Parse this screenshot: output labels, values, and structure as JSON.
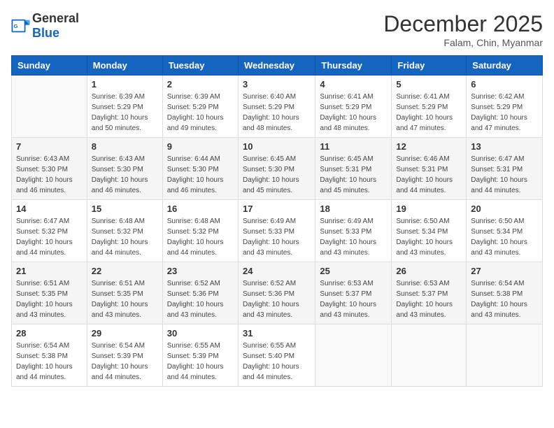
{
  "header": {
    "logo_general": "General",
    "logo_blue": "Blue",
    "month_title": "December 2025",
    "subtitle": "Falam, Chin, Myanmar"
  },
  "columns": [
    "Sunday",
    "Monday",
    "Tuesday",
    "Wednesday",
    "Thursday",
    "Friday",
    "Saturday"
  ],
  "weeks": [
    [
      {
        "day": "",
        "info": ""
      },
      {
        "day": "1",
        "info": "Sunrise: 6:39 AM\nSunset: 5:29 PM\nDaylight: 10 hours\nand 50 minutes."
      },
      {
        "day": "2",
        "info": "Sunrise: 6:39 AM\nSunset: 5:29 PM\nDaylight: 10 hours\nand 49 minutes."
      },
      {
        "day": "3",
        "info": "Sunrise: 6:40 AM\nSunset: 5:29 PM\nDaylight: 10 hours\nand 48 minutes."
      },
      {
        "day": "4",
        "info": "Sunrise: 6:41 AM\nSunset: 5:29 PM\nDaylight: 10 hours\nand 48 minutes."
      },
      {
        "day": "5",
        "info": "Sunrise: 6:41 AM\nSunset: 5:29 PM\nDaylight: 10 hours\nand 47 minutes."
      },
      {
        "day": "6",
        "info": "Sunrise: 6:42 AM\nSunset: 5:29 PM\nDaylight: 10 hours\nand 47 minutes."
      }
    ],
    [
      {
        "day": "7",
        "info": "Sunrise: 6:43 AM\nSunset: 5:30 PM\nDaylight: 10 hours\nand 46 minutes."
      },
      {
        "day": "8",
        "info": "Sunrise: 6:43 AM\nSunset: 5:30 PM\nDaylight: 10 hours\nand 46 minutes."
      },
      {
        "day": "9",
        "info": "Sunrise: 6:44 AM\nSunset: 5:30 PM\nDaylight: 10 hours\nand 46 minutes."
      },
      {
        "day": "10",
        "info": "Sunrise: 6:45 AM\nSunset: 5:30 PM\nDaylight: 10 hours\nand 45 minutes."
      },
      {
        "day": "11",
        "info": "Sunrise: 6:45 AM\nSunset: 5:31 PM\nDaylight: 10 hours\nand 45 minutes."
      },
      {
        "day": "12",
        "info": "Sunrise: 6:46 AM\nSunset: 5:31 PM\nDaylight: 10 hours\nand 44 minutes."
      },
      {
        "day": "13",
        "info": "Sunrise: 6:47 AM\nSunset: 5:31 PM\nDaylight: 10 hours\nand 44 minutes."
      }
    ],
    [
      {
        "day": "14",
        "info": "Sunrise: 6:47 AM\nSunset: 5:32 PM\nDaylight: 10 hours\nand 44 minutes."
      },
      {
        "day": "15",
        "info": "Sunrise: 6:48 AM\nSunset: 5:32 PM\nDaylight: 10 hours\nand 44 minutes."
      },
      {
        "day": "16",
        "info": "Sunrise: 6:48 AM\nSunset: 5:32 PM\nDaylight: 10 hours\nand 44 minutes."
      },
      {
        "day": "17",
        "info": "Sunrise: 6:49 AM\nSunset: 5:33 PM\nDaylight: 10 hours\nand 43 minutes."
      },
      {
        "day": "18",
        "info": "Sunrise: 6:49 AM\nSunset: 5:33 PM\nDaylight: 10 hours\nand 43 minutes."
      },
      {
        "day": "19",
        "info": "Sunrise: 6:50 AM\nSunset: 5:34 PM\nDaylight: 10 hours\nand 43 minutes."
      },
      {
        "day": "20",
        "info": "Sunrise: 6:50 AM\nSunset: 5:34 PM\nDaylight: 10 hours\nand 43 minutes."
      }
    ],
    [
      {
        "day": "21",
        "info": "Sunrise: 6:51 AM\nSunset: 5:35 PM\nDaylight: 10 hours\nand 43 minutes."
      },
      {
        "day": "22",
        "info": "Sunrise: 6:51 AM\nSunset: 5:35 PM\nDaylight: 10 hours\nand 43 minutes."
      },
      {
        "day": "23",
        "info": "Sunrise: 6:52 AM\nSunset: 5:36 PM\nDaylight: 10 hours\nand 43 minutes."
      },
      {
        "day": "24",
        "info": "Sunrise: 6:52 AM\nSunset: 5:36 PM\nDaylight: 10 hours\nand 43 minutes."
      },
      {
        "day": "25",
        "info": "Sunrise: 6:53 AM\nSunset: 5:37 PM\nDaylight: 10 hours\nand 43 minutes."
      },
      {
        "day": "26",
        "info": "Sunrise: 6:53 AM\nSunset: 5:37 PM\nDaylight: 10 hours\nand 43 minutes."
      },
      {
        "day": "27",
        "info": "Sunrise: 6:54 AM\nSunset: 5:38 PM\nDaylight: 10 hours\nand 43 minutes."
      }
    ],
    [
      {
        "day": "28",
        "info": "Sunrise: 6:54 AM\nSunset: 5:38 PM\nDaylight: 10 hours\nand 44 minutes."
      },
      {
        "day": "29",
        "info": "Sunrise: 6:54 AM\nSunset: 5:39 PM\nDaylight: 10 hours\nand 44 minutes."
      },
      {
        "day": "30",
        "info": "Sunrise: 6:55 AM\nSunset: 5:39 PM\nDaylight: 10 hours\nand 44 minutes."
      },
      {
        "day": "31",
        "info": "Sunrise: 6:55 AM\nSunset: 5:40 PM\nDaylight: 10 hours\nand 44 minutes."
      },
      {
        "day": "",
        "info": ""
      },
      {
        "day": "",
        "info": ""
      },
      {
        "day": "",
        "info": ""
      }
    ]
  ]
}
